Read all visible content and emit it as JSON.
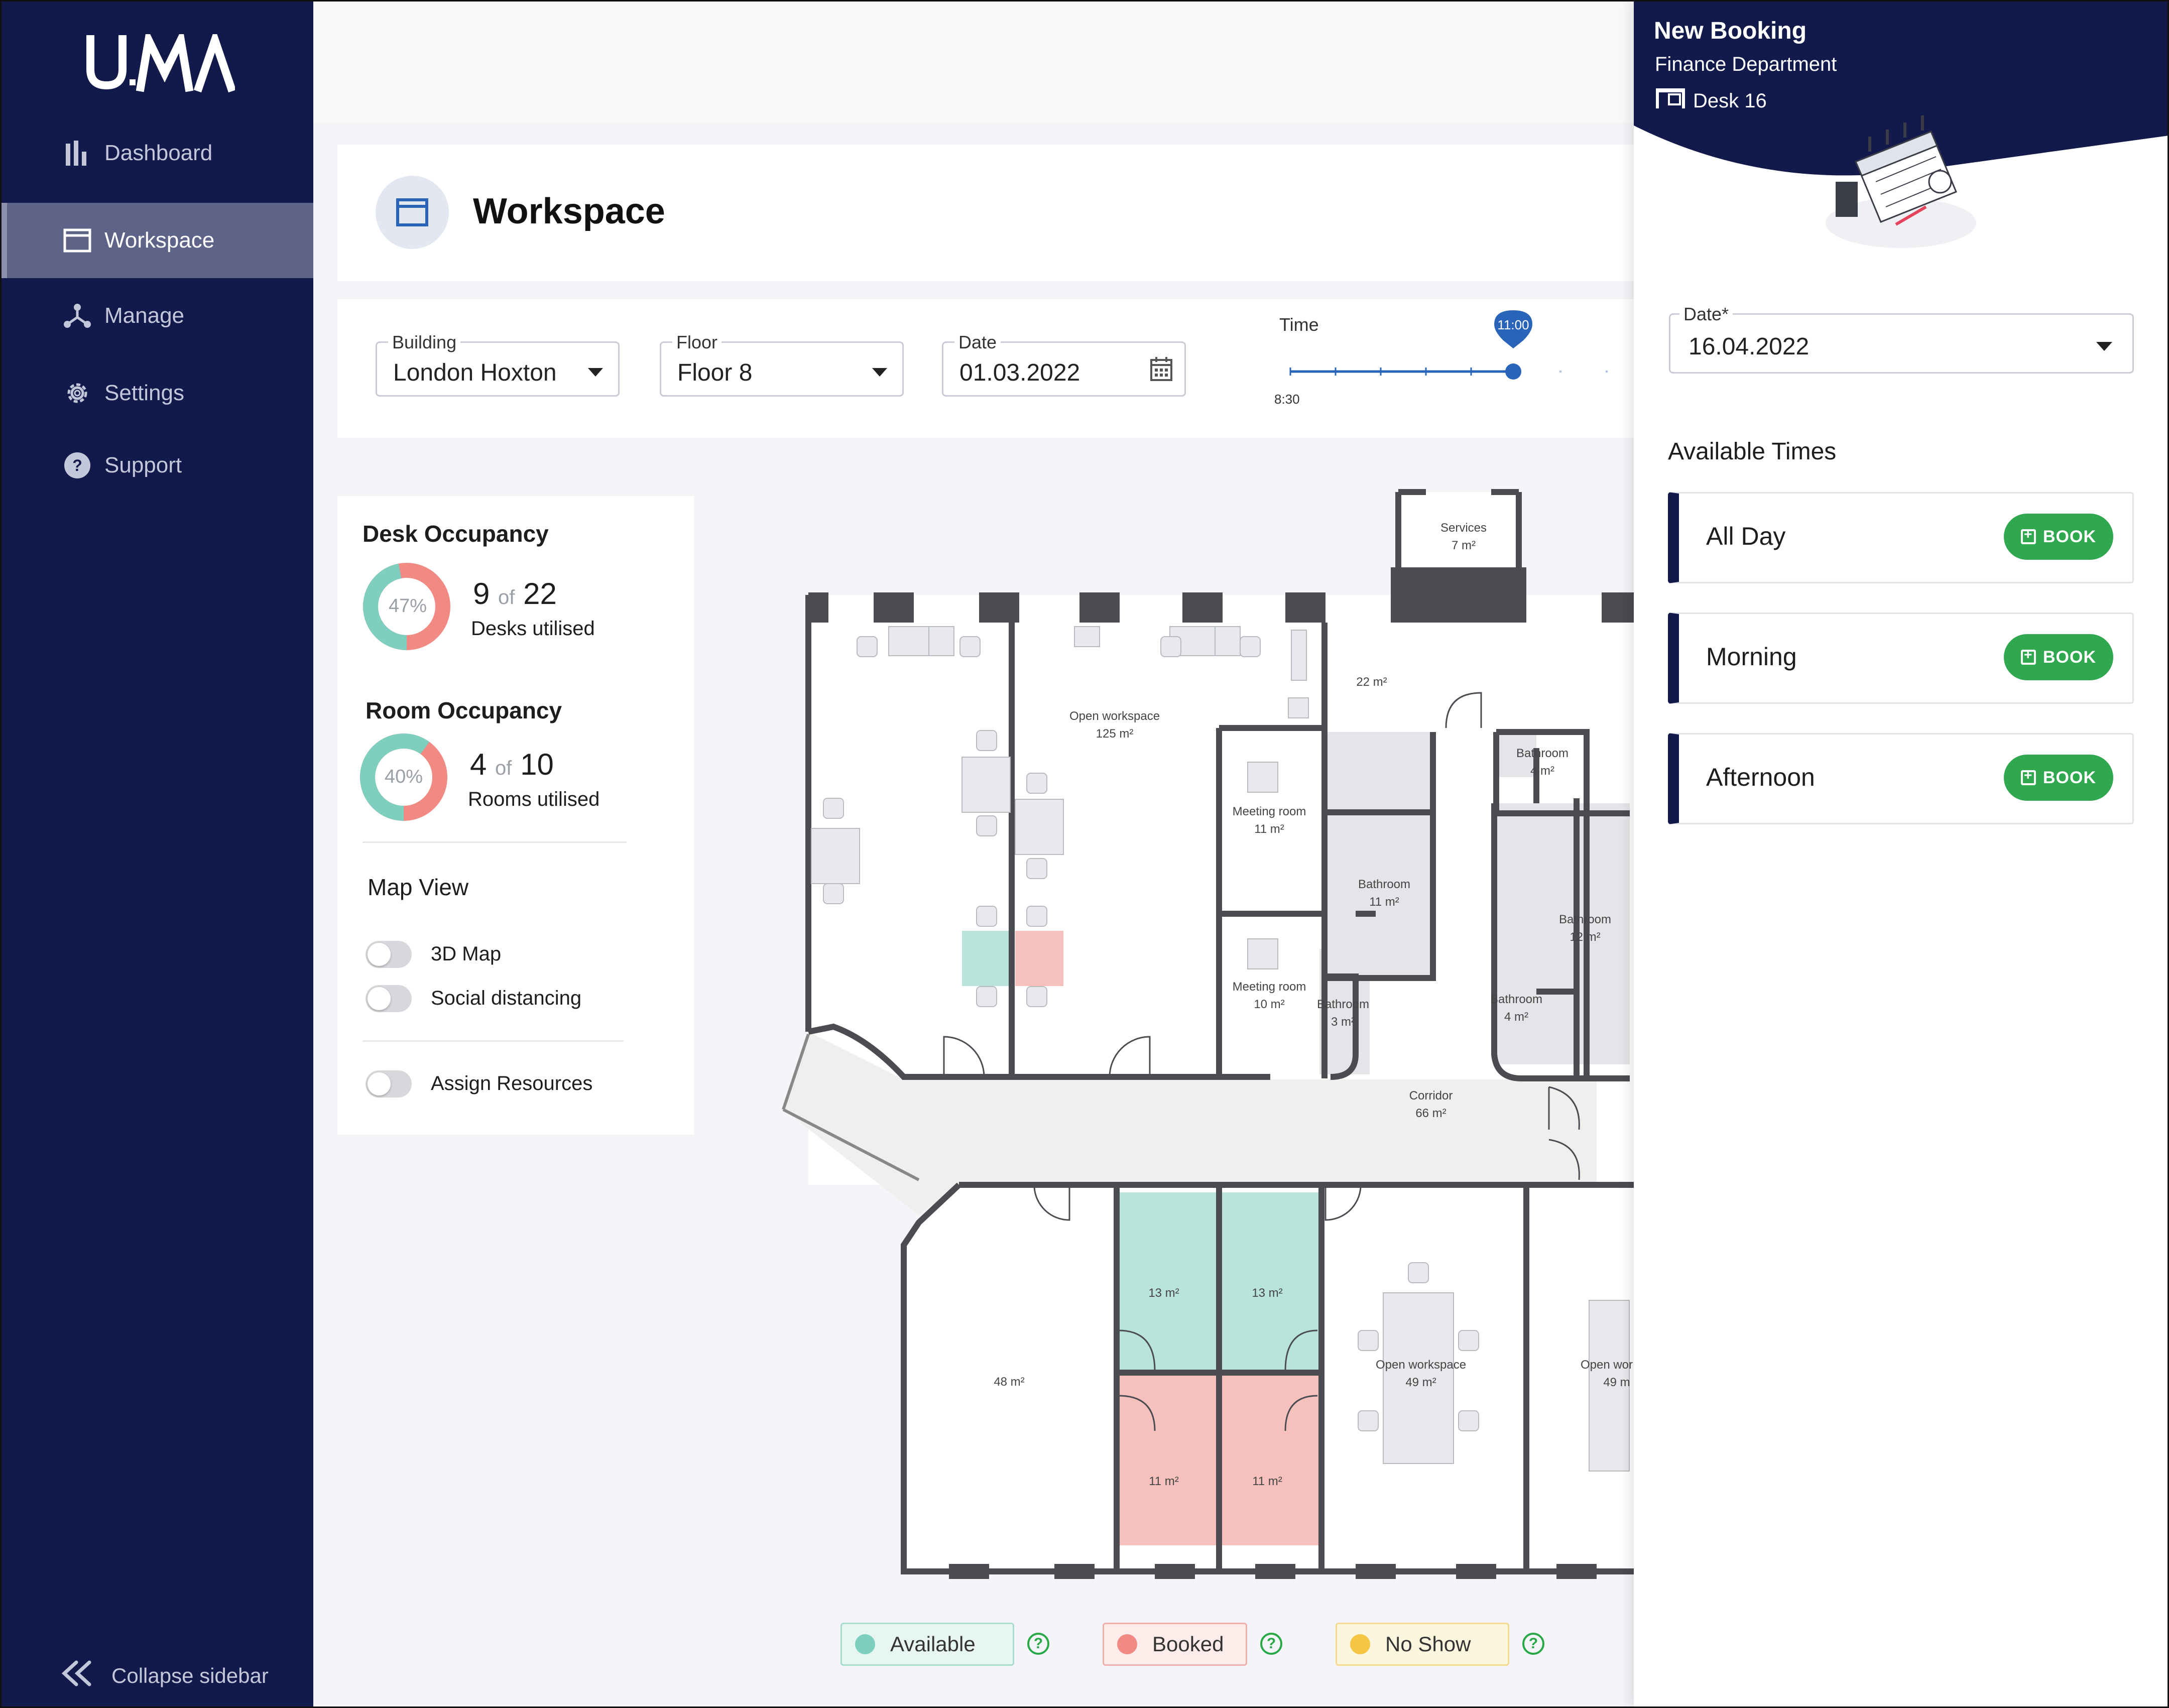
{
  "sidebar": {
    "logo": "UMA",
    "items": [
      {
        "label": "Dashboard",
        "icon": "bar-chart-icon"
      },
      {
        "label": "Workspace",
        "icon": "window-icon",
        "active": true
      },
      {
        "label": "Manage",
        "icon": "network-icon"
      },
      {
        "label": "Settings",
        "icon": "gear-icon"
      },
      {
        "label": "Support",
        "icon": "help-circle-icon"
      }
    ],
    "collapse_label": "Collapse sidebar"
  },
  "header": {
    "title": "Workspace"
  },
  "filters": {
    "building": {
      "label": "Building",
      "value": "London Hoxton"
    },
    "floor": {
      "label": "Floor",
      "value": "Floor 8"
    },
    "date": {
      "label": "Date",
      "value": "01.03.2022"
    },
    "time": {
      "label": "Time",
      "start": "8:30",
      "selected": "11:00"
    }
  },
  "occupancy": {
    "desk": {
      "title": "Desk Occupancy",
      "percent_label": "47%",
      "used": "9",
      "of": "of",
      "total": "22",
      "caption": "Desks utilised"
    },
    "room": {
      "title": "Room Occupancy",
      "percent_label": "40%",
      "used": "4",
      "of": "of",
      "total": "10",
      "caption": "Rooms utilised"
    },
    "map_view": {
      "title": "Map View",
      "toggles": [
        {
          "label": "3D Map",
          "on": false
        },
        {
          "label": "Social distancing",
          "on": false
        },
        {
          "label": "Assign Resources",
          "on": false
        }
      ]
    }
  },
  "floorplan": {
    "labels": {
      "services": "Services",
      "services_area": "7 m²",
      "open_ws": "Open workspace",
      "open_ws_area": "125 m²",
      "room22": "22 m²",
      "bath1": "Bathroom",
      "bath1_area": "4 m²",
      "meeting1": "Meeting room",
      "meeting1_area": "11 m²",
      "bath2": "Bathroom",
      "bath2_area": "11 m²",
      "bath3": "Bathroom",
      "bath3_area": "12 m²",
      "meeting2": "Meeting room",
      "meeting2_area": "10 m²",
      "bath4": "Bathroom",
      "bath4_area": "3 m²",
      "bath5": "Bathroom",
      "bath5_area": "4 m²",
      "corridor": "Corridor",
      "corridor_area": "66 m²",
      "r13a": "13 m²",
      "r13b": "13 m²",
      "r48": "48 m²",
      "r11a": "11 m²",
      "r11b": "11 m²",
      "open_ws2": "Open workspace",
      "open_ws2_area": "49 m²",
      "open_ws3": "Open wor",
      "open_ws3_area": "49 m"
    }
  },
  "legend": [
    {
      "label": "Available",
      "color": "#7fcfc0"
    },
    {
      "label": "Booked",
      "color": "#f08a82"
    },
    {
      "label": "No Show",
      "color": "#f6c544"
    }
  ],
  "booking": {
    "title": "New Booking",
    "department": "Finance Department",
    "desk": "Desk 16",
    "date_label": "Date*",
    "date_value": "16.04.2022",
    "available_title": "Available Times",
    "book_label": "BOOK",
    "slots": [
      "All Day",
      "Morning",
      "Afternoon"
    ]
  },
  "colors": {
    "navy": "#121a4b",
    "available": "#b9e4dc",
    "booked": "#f6c1bd",
    "book_button": "#2fa84f"
  }
}
